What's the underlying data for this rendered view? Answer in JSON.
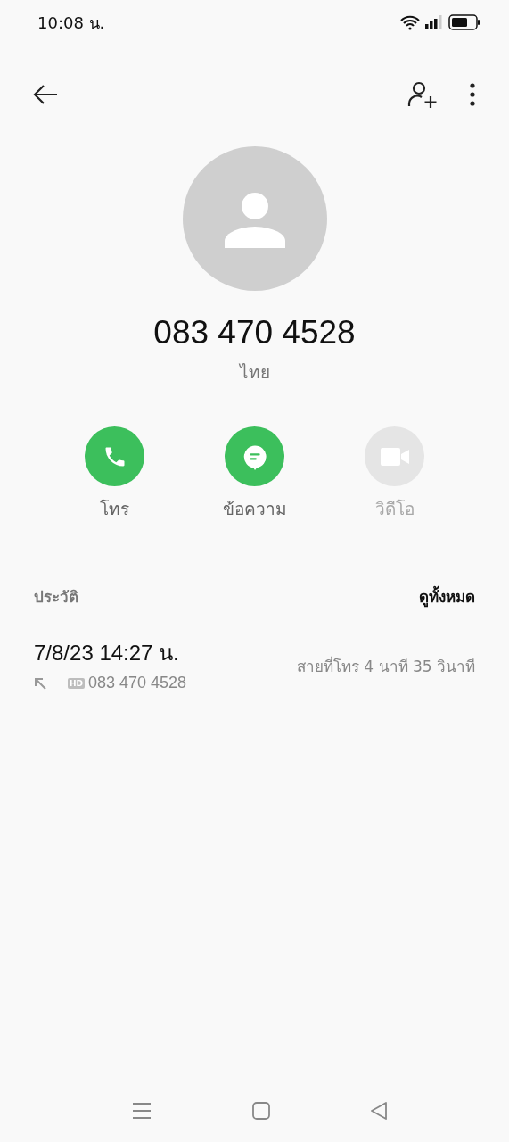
{
  "status_bar": {
    "time": "10:08 น."
  },
  "contact": {
    "number": "083 470 4528",
    "location": "ไทย"
  },
  "actions": [
    {
      "kind": "call",
      "label": "โทร",
      "disabled": false
    },
    {
      "kind": "message",
      "label": "ข้อความ",
      "disabled": false
    },
    {
      "kind": "video",
      "label": "วิดีโอ",
      "disabled": true
    }
  ],
  "history": {
    "title": "ประวัติ",
    "see_all": "ดูทั้งหมด",
    "entries": [
      {
        "datetime": "7/8/23 14:27 น.",
        "badge": "HD",
        "number": "083 470 4528",
        "type": "สายที่โทร",
        "duration": "4 นาที 35 วินาที"
      }
    ]
  }
}
